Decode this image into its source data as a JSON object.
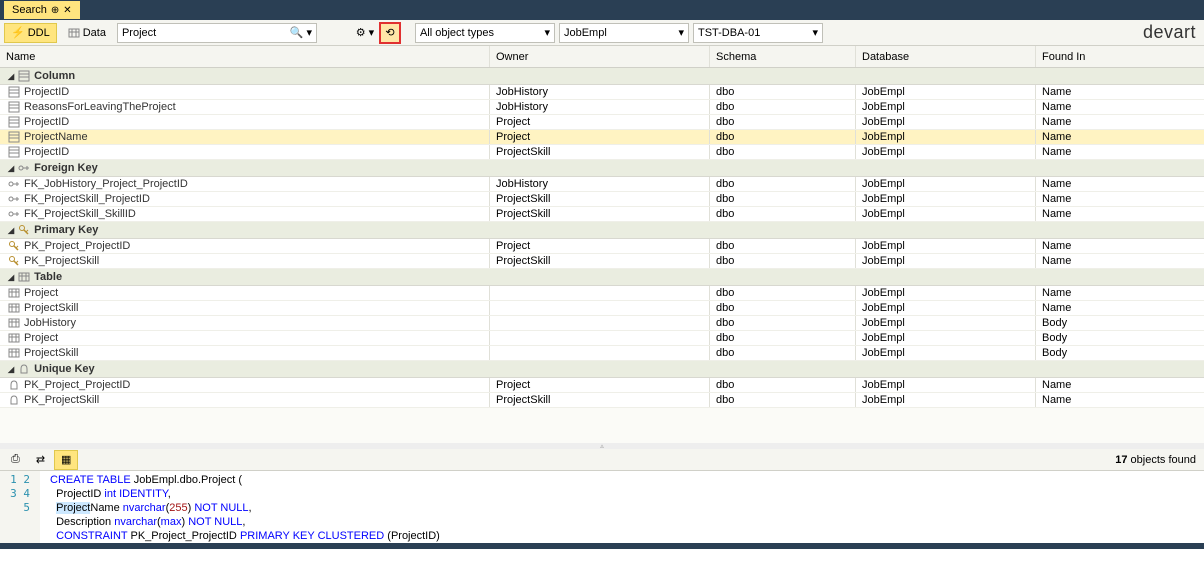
{
  "tab": {
    "title": "Search"
  },
  "toolbar": {
    "ddl": "DDL",
    "data": "Data",
    "search_value": "Project",
    "object_types": "All object types",
    "schema_filter": "JobEmpl",
    "server_filter": "TST-DBA-01"
  },
  "brand": "devart",
  "columns": {
    "name": "Name",
    "owner": "Owner",
    "schema": "Schema",
    "database": "Database",
    "found": "Found In"
  },
  "groups": [
    {
      "icon": "column",
      "label": "Column",
      "rows": [
        {
          "icon": "column",
          "name": "ProjectID",
          "owner": "JobHistory",
          "schema": "dbo",
          "db": "JobEmpl",
          "found": "Name"
        },
        {
          "icon": "column",
          "name": "ReasonsForLeavingTheProject",
          "owner": "JobHistory",
          "schema": "dbo",
          "db": "JobEmpl",
          "found": "Name"
        },
        {
          "icon": "column",
          "name": "ProjectID",
          "owner": "Project",
          "schema": "dbo",
          "db": "JobEmpl",
          "found": "Name"
        },
        {
          "icon": "column",
          "name": "ProjectName",
          "owner": "Project",
          "schema": "dbo",
          "db": "JobEmpl",
          "found": "Name",
          "hl": true
        },
        {
          "icon": "column",
          "name": "ProjectID",
          "owner": "ProjectSkill",
          "schema": "dbo",
          "db": "JobEmpl",
          "found": "Name"
        }
      ]
    },
    {
      "icon": "fk",
      "label": "Foreign Key",
      "rows": [
        {
          "icon": "fk",
          "name": "FK_JobHistory_Project_ProjectID",
          "owner": "JobHistory",
          "schema": "dbo",
          "db": "JobEmpl",
          "found": "Name"
        },
        {
          "icon": "fk",
          "name": "FK_ProjectSkill_ProjectID",
          "owner": "ProjectSkill",
          "schema": "dbo",
          "db": "JobEmpl",
          "found": "Name"
        },
        {
          "icon": "fk",
          "name": "FK_ProjectSkill_SkillID",
          "owner": "ProjectSkill",
          "schema": "dbo",
          "db": "JobEmpl",
          "found": "Name"
        }
      ]
    },
    {
      "icon": "pk",
      "label": "Primary Key",
      "rows": [
        {
          "icon": "pk",
          "name": "PK_Project_ProjectID",
          "owner": "Project",
          "schema": "dbo",
          "db": "JobEmpl",
          "found": "Name"
        },
        {
          "icon": "pk",
          "name": "PK_ProjectSkill",
          "owner": "ProjectSkill",
          "schema": "dbo",
          "db": "JobEmpl",
          "found": "Name"
        }
      ]
    },
    {
      "icon": "table",
      "label": "Table",
      "rows": [
        {
          "icon": "table",
          "name": "Project",
          "owner": "",
          "schema": "dbo",
          "db": "JobEmpl",
          "found": "Name"
        },
        {
          "icon": "table",
          "name": "ProjectSkill",
          "owner": "",
          "schema": "dbo",
          "db": "JobEmpl",
          "found": "Name"
        },
        {
          "icon": "table",
          "name": "JobHistory",
          "owner": "",
          "schema": "dbo",
          "db": "JobEmpl",
          "found": "Body"
        },
        {
          "icon": "table",
          "name": "Project",
          "owner": "",
          "schema": "dbo",
          "db": "JobEmpl",
          "found": "Body"
        },
        {
          "icon": "table",
          "name": "ProjectSkill",
          "owner": "",
          "schema": "dbo",
          "db": "JobEmpl",
          "found": "Body"
        }
      ]
    },
    {
      "icon": "uk",
      "label": "Unique Key",
      "rows": [
        {
          "icon": "uk",
          "name": "PK_Project_ProjectID",
          "owner": "Project",
          "schema": "dbo",
          "db": "JobEmpl",
          "found": "Name"
        },
        {
          "icon": "uk",
          "name": "PK_ProjectSkill",
          "owner": "ProjectSkill",
          "schema": "dbo",
          "db": "JobEmpl",
          "found": "Name"
        }
      ]
    }
  ],
  "footer": {
    "count_num": "17",
    "count_text": " objects found",
    "lines": [
      "1",
      "2",
      "3",
      "4",
      "5"
    ],
    "code": {
      "l1_a": "CREATE TABLE",
      "l1_b": " JobEmpl.dbo.Project (",
      "l2_a": "  ProjectID ",
      "l2_b": "int IDENTITY",
      "l2_c": ",",
      "l3_a": "  ",
      "l3_sel": "Project",
      "l3_b": "Name ",
      "l3_c": "nvarchar",
      "l3_d": "(",
      "l3_e": "255",
      "l3_f": ") ",
      "l3_g": "NOT NULL",
      "l3_h": ",",
      "l4_a": "  Description ",
      "l4_b": "nvarchar",
      "l4_c": "(",
      "l4_d": "max",
      "l4_e": ") ",
      "l4_f": "NOT NULL",
      "l4_g": ",",
      "l5_a": "  ",
      "l5_b": "CONSTRAINT",
      "l5_c": " PK_Project_ProjectID ",
      "l5_d": "PRIMARY KEY CLUSTERED",
      "l5_e": " (ProjectID)"
    }
  }
}
